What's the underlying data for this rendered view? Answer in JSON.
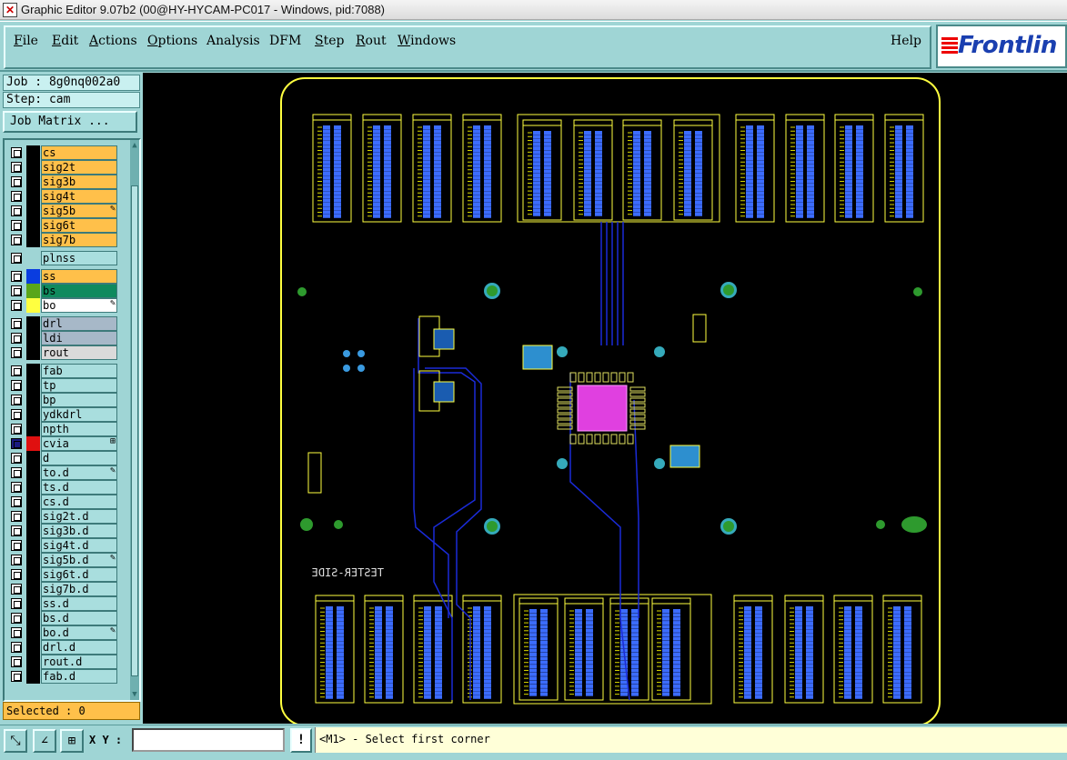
{
  "window": {
    "title": "Graphic Editor 9.07b2 (00@HY-HYCAM-PC017 - Windows, pid:7088)",
    "app_icon": "x-icon"
  },
  "menu": {
    "items": [
      {
        "label": "File",
        "u": "F",
        "rest": "ile"
      },
      {
        "label": "Edit",
        "u": "E",
        "rest": "dit"
      },
      {
        "label": "Actions",
        "u": "A",
        "rest": "ctions"
      },
      {
        "label": "Options",
        "u": "O",
        "rest": "ptions"
      },
      {
        "label": "Analysis",
        "u": "",
        "rest": "Analysis"
      },
      {
        "label": "DFM",
        "u": "",
        "rest": "DFM"
      },
      {
        "label": "Step",
        "u": "S",
        "rest": "tep"
      },
      {
        "label": "Rout",
        "u": "R",
        "rest": "out"
      },
      {
        "label": "Windows",
        "u": "W",
        "rest": "indows"
      }
    ],
    "help": "Help",
    "logo_text": "Frontlin"
  },
  "panel": {
    "job": "Job : 8g0nq002a0",
    "step": "Step: cam",
    "job_matrix": "Job Matrix ...",
    "selected": "Selected : 0"
  },
  "layer_groups": [
    {
      "color": "#ffc04a",
      "layers": [
        {
          "name": "cs",
          "swatch": "#000",
          "mark": ""
        },
        {
          "name": "sig2t",
          "swatch": "#000",
          "mark": ""
        },
        {
          "name": "sig3b",
          "swatch": "#000",
          "mark": ""
        },
        {
          "name": "sig4t",
          "swatch": "#000",
          "mark": ""
        },
        {
          "name": "sig5b",
          "swatch": "#000",
          "mark": "pencil-icon"
        },
        {
          "name": "sig6t",
          "swatch": "#000",
          "mark": ""
        },
        {
          "name": "sig7b",
          "swatch": "#000",
          "mark": ""
        }
      ]
    },
    {
      "color": "#a9dede",
      "layers": [
        {
          "name": "plnss",
          "swatch": "#9fd5d5",
          "mark": ""
        }
      ]
    },
    {
      "color": "#ffc04a",
      "layers": [
        {
          "name": "ss",
          "swatch": "#0a3de0",
          "mark": "",
          "bg": "#ffc04a"
        },
        {
          "name": "bs",
          "swatch": "#5aa61a",
          "mark": "",
          "bg": "#0f8a5e"
        },
        {
          "name": "bo",
          "swatch": "#ffff40",
          "mark": "pencil-icon",
          "bg": "#ffffff"
        }
      ]
    },
    {
      "color": "#a9b9c9",
      "layers": [
        {
          "name": "drl",
          "swatch": "#000",
          "mark": "",
          "bg": "#a7b8c8"
        },
        {
          "name": "ldi",
          "swatch": "#000",
          "mark": "",
          "bg": "#a7b8c8"
        },
        {
          "name": "rout",
          "swatch": "#000",
          "mark": "",
          "bg": "#dadada"
        }
      ]
    },
    {
      "color": "#a9dede",
      "layers": [
        {
          "name": "fab",
          "swatch": "#000",
          "mark": ""
        },
        {
          "name": "tp",
          "swatch": "#000",
          "mark": ""
        },
        {
          "name": "bp",
          "swatch": "#000",
          "mark": ""
        },
        {
          "name": "ydkdrl",
          "swatch": "#000",
          "mark": ""
        },
        {
          "name": "npth",
          "swatch": "#000",
          "mark": ""
        },
        {
          "name": "cvia",
          "swatch": "#e01010",
          "mark": "grid-icon",
          "on": true
        },
        {
          "name": "d",
          "swatch": "#000",
          "mark": ""
        },
        {
          "name": "to.d",
          "swatch": "#000",
          "mark": "pencil-icon"
        },
        {
          "name": "ts.d",
          "swatch": "#000",
          "mark": ""
        },
        {
          "name": "cs.d",
          "swatch": "#000",
          "mark": ""
        },
        {
          "name": "sig2t.d",
          "swatch": "#000",
          "mark": ""
        },
        {
          "name": "sig3b.d",
          "swatch": "#000",
          "mark": ""
        },
        {
          "name": "sig4t.d",
          "swatch": "#000",
          "mark": ""
        },
        {
          "name": "sig5b.d",
          "swatch": "#000",
          "mark": "pencil-icon"
        },
        {
          "name": "sig6t.d",
          "swatch": "#000",
          "mark": ""
        },
        {
          "name": "sig7b.d",
          "swatch": "#000",
          "mark": ""
        },
        {
          "name": "ss.d",
          "swatch": "#000",
          "mark": ""
        },
        {
          "name": "bs.d",
          "swatch": "#000",
          "mark": ""
        },
        {
          "name": "bo.d",
          "swatch": "#000",
          "mark": "pencil-icon"
        },
        {
          "name": "drl.d",
          "swatch": "#000",
          "mark": ""
        },
        {
          "name": "rout.d",
          "swatch": "#000",
          "mark": ""
        },
        {
          "name": "fab.d",
          "swatch": "#000",
          "mark": ""
        }
      ]
    }
  ],
  "board": {
    "label_tester_side": "TESTER-SIDE",
    "colors": {
      "outline": "#ffff40",
      "pad": "#3c6cff",
      "trace": "#1a2bd8",
      "via": "#2e9a2e",
      "ic": "#e040e0"
    }
  },
  "bottom": {
    "xy_label": "X Y :",
    "xy_value": "",
    "warn": "!",
    "status": "<M1> - Select first corner"
  }
}
